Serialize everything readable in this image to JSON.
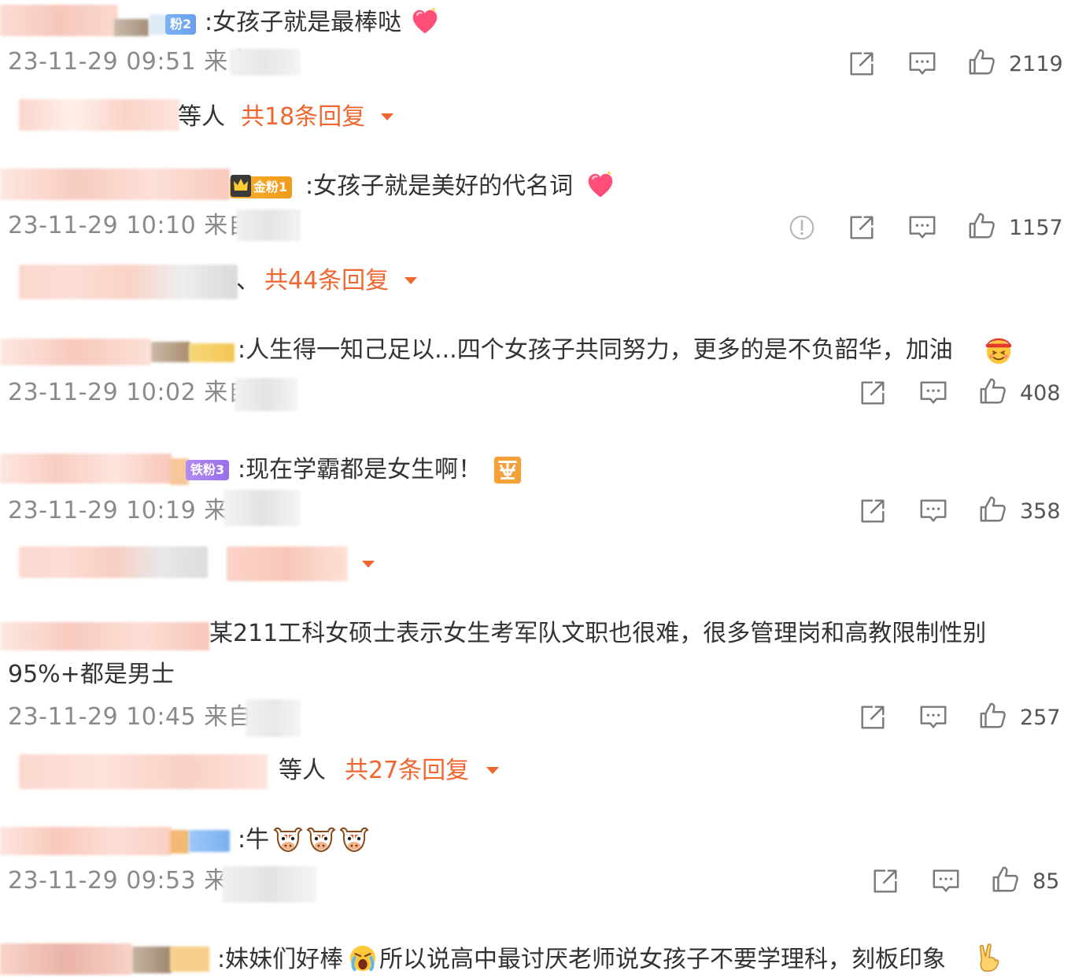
{
  "colors": {
    "reply_accent": "#f0662e",
    "meta_gray": "#8a8a8a",
    "text": "#333333",
    "icon_gray": "#7a7a7a"
  },
  "icons": {
    "share": "share-icon",
    "comment": "comment-icon",
    "like": "like-icon",
    "report": "report-icon"
  },
  "comments": [
    {
      "badge": "粉2",
      "text": ":女孩子就是最棒哒",
      "emoji": "heart-emoji",
      "time": "23-11-29 09:51 来自",
      "likes": "2119",
      "reply_suffix": "等人",
      "reply_link": "共18条回复"
    },
    {
      "badge": "金粉1",
      "text": ":女孩子就是美好的代名词",
      "emoji": "heart-emoji",
      "time": "23-11-29 10:10 来自",
      "likes": "1157",
      "reply_suffix": "、",
      "reply_link": "共44条回复"
    },
    {
      "text": ":人生得一知己足以...四个女孩子共同努力，更多的是不负韶华，加油",
      "emoji": "cheer-emoji",
      "time": "23-11-29 10:02 来自",
      "likes": "408"
    },
    {
      "badge": "铁粉3",
      "text": ":现在学霸都是女生啊！",
      "emoji": "zan-emoji",
      "time": "23-11-29 10:19 来",
      "likes": "358"
    },
    {
      "text_line1": "某211工科女硕士表示女生考军队文职也很难，很多管理岗和高教限制性别",
      "text_line2": "95%+都是男士",
      "time": "23-11-29 10:45 来自",
      "likes": "257",
      "reply_suffix": "等人",
      "reply_link": "共27条回复"
    },
    {
      "text": ":牛",
      "emoji": "cow-emoji",
      "time": "23-11-29 09:53 来",
      "likes": "85"
    },
    {
      "text_a": ":妹妹们好棒",
      "text_b": "所以说高中最讨厌老师说女孩子不要学理科，刻板印象",
      "emoji_a": "cry-emoji",
      "emoji_b": "victory-emoji"
    }
  ]
}
